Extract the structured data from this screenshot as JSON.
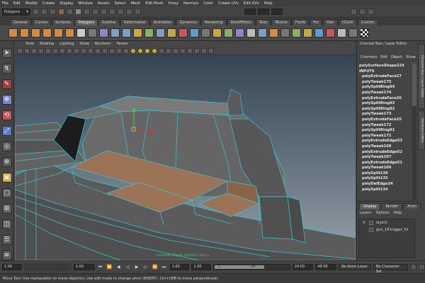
{
  "menubar": {
    "items": [
      "File",
      "Edit",
      "Modify",
      "Create",
      "Display",
      "Window",
      "Assets",
      "Select",
      "Mesh",
      "Edit Mesh",
      "Proxy",
      "Normals",
      "Color",
      "Create UVs",
      "Edit UVs",
      "Help"
    ]
  },
  "statusline": {
    "mode": "Polygons"
  },
  "shelf": {
    "tabs": [
      "General",
      "Curves",
      "Surfaces",
      "Polygons",
      "Subdivs",
      "Deformation",
      "Animation",
      "Dynamics",
      "Rendering",
      "PaintEffects",
      "Toon",
      "Muscle",
      "Fluids",
      "Fur",
      "Hair",
      "nCloth",
      "Custom"
    ],
    "active_tab": "Polygons"
  },
  "viewport": {
    "menu": [
      "View",
      "Shading",
      "Lighting",
      "Show",
      "Renderer",
      "Panels"
    ]
  },
  "channelbox": {
    "title": "Channel Box / Layer Editor",
    "menu": [
      "Channels",
      "Edit",
      "Object",
      "Show"
    ],
    "items": [
      "polySurfaceShape224",
      "INPUTS",
      "polyExtrudeFace27",
      "polyTweak175",
      "polySplitRing94",
      "polyTweak174",
      "polyExtrudeFace26",
      "polySplitRing93",
      "polySplitRing92",
      "polyTweak173",
      "polyExtrudeFace25",
      "polyTweak172",
      "polySplitRing91",
      "polyTweak171",
      "polyExtrudeEdge53",
      "polyTweak168",
      "polyExtrudeEdge52",
      "polyTweak167",
      "polyExtrudeEdge51",
      "polyTweak166",
      "polySplit136",
      "polySplit135",
      "polyDelEdge34",
      "polySplit134"
    ],
    "side_tabs": [
      "Channel Box / Layer Editor",
      "Attribute Editor"
    ]
  },
  "layers": {
    "tabs": [
      "Display",
      "Render",
      "Anim"
    ],
    "active_tab": "Display",
    "menu": [
      "Layers",
      "Options",
      "Help"
    ],
    "rows": [
      {
        "visible": "V",
        "name": "layer1"
      },
      {
        "visible": "",
        "name": "gun_18:trigger_01"
      }
    ]
  },
  "timeslider": {
    "ticks": [
      "1",
      "2",
      "4",
      "6",
      "8",
      "10",
      "12",
      "14",
      "16",
      "18",
      "20",
      "22",
      "24"
    ],
    "current_frame": "1.00"
  },
  "rangeslider": {
    "start_time": "1.00",
    "current": "1.00",
    "playback_start": "1.00",
    "range_start": "1",
    "range_end": "24",
    "playback_end": "24.00",
    "end_time": "48.00",
    "anim_layer": "No Anim Layer",
    "character_set": "No Character Set"
  },
  "scene": {
    "label": "Camera Shape (persp) Lens 1"
  },
  "helpline": {
    "text": "Move Tool: Use manipulator to move object(s). Use edit mode to change pivot (INSERT). Ctrl+LMB to move perpendicular."
  },
  "colors": {
    "wire": "#36c8d8",
    "face_top": "#9c7356",
    "mesh_side": "#6b6b6b",
    "viewport_bg_top": "#3a4a57",
    "viewport_bg_bottom": "#8e9aa4"
  }
}
